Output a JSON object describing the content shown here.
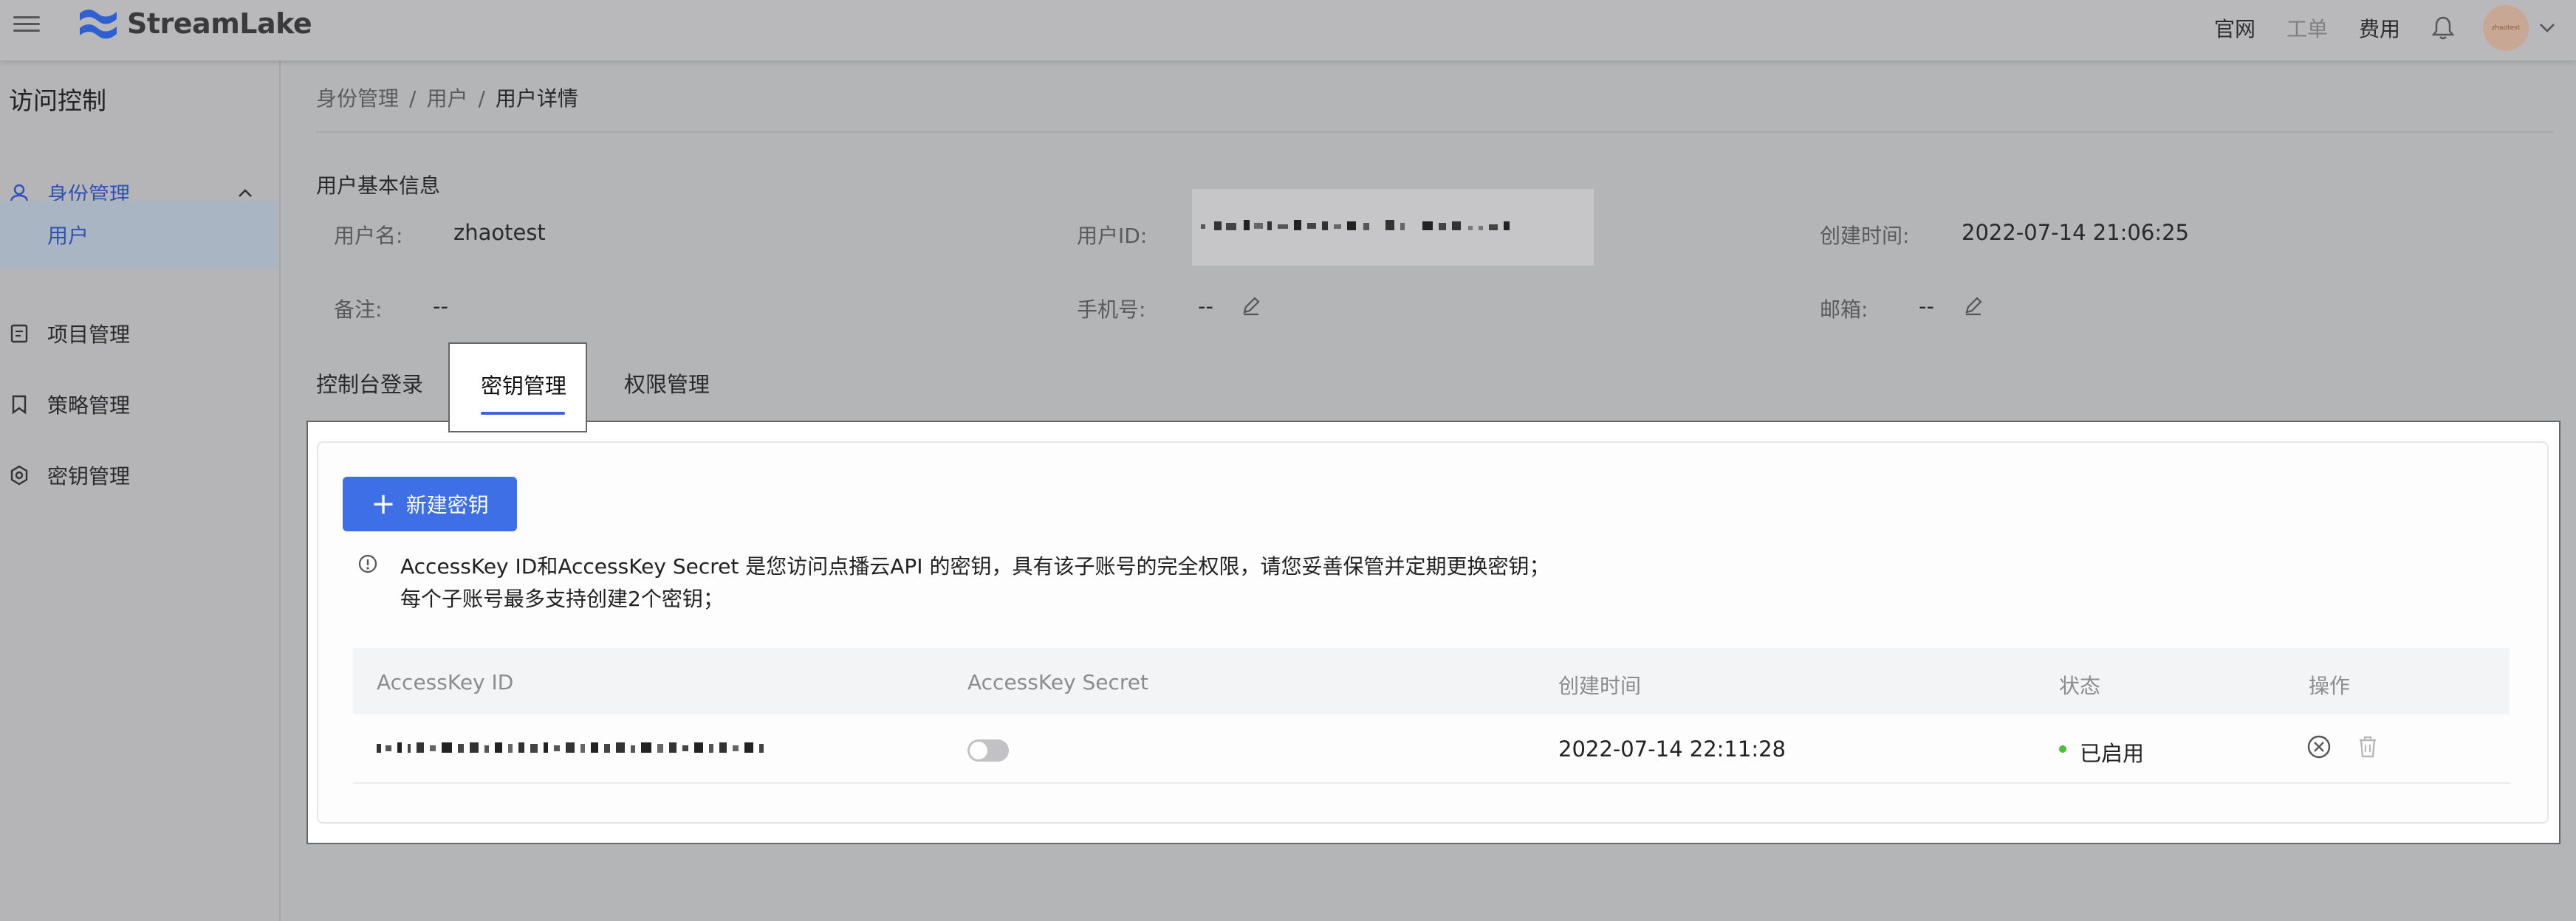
{
  "topbar": {
    "brand": "StreamLake",
    "links": [
      "官网",
      "工单",
      "费用"
    ],
    "icons": [
      "menu-icon",
      "bell-icon",
      "chevron-down-icon"
    ],
    "avatar_text": "zhaotest"
  },
  "sidebar": {
    "title": "访问控制",
    "items": [
      {
        "label": "身份管理",
        "icon": "user-icon"
      },
      {
        "label": "用户"
      },
      {
        "label": "项目管理",
        "icon": "document-icon"
      },
      {
        "label": "策略管理",
        "icon": "bookmark-icon"
      },
      {
        "label": "密钥管理",
        "icon": "gear-icon"
      }
    ]
  },
  "breadcrumb": [
    "身份管理",
    "用户",
    "用户详情"
  ],
  "breadcrumb_sep": "/",
  "user_info": {
    "section_title": "用户基本信息",
    "username_label": "用户名:",
    "username": "zhaotest",
    "userid_label": "用户ID:",
    "created_label": "创建时间:",
    "created": "2022-07-14 21:06:25",
    "note_label": "备注:",
    "note": "--",
    "phone_label": "手机号:",
    "phone": "--",
    "email_label": "邮箱:",
    "email": "--"
  },
  "tabs": [
    "控制台登录",
    "密钥管理",
    "权限管理"
  ],
  "active_tab": "密钥管理",
  "keys": {
    "new_button": "新建密钥",
    "notice_line1": "AccessKey ID和AccessKey Secret 是您访问点播云API 的密钥，具有该子账号的完全权限，请您妥善保管并定期更换密钥；",
    "notice_line2": "每个子账号最多支持创建2个密钥；",
    "columns": [
      "AccessKey ID",
      "AccessKey Secret",
      "创建时间",
      "状态",
      "操作"
    ],
    "rows": [
      {
        "created": "2022-07-14 22:11:28",
        "status": "已启用",
        "secret_shown": false
      }
    ]
  },
  "colors": {
    "accent": "#3f6fe6",
    "status_enabled": "#4cbf3a",
    "sidebar_active": "#2f52b8"
  }
}
